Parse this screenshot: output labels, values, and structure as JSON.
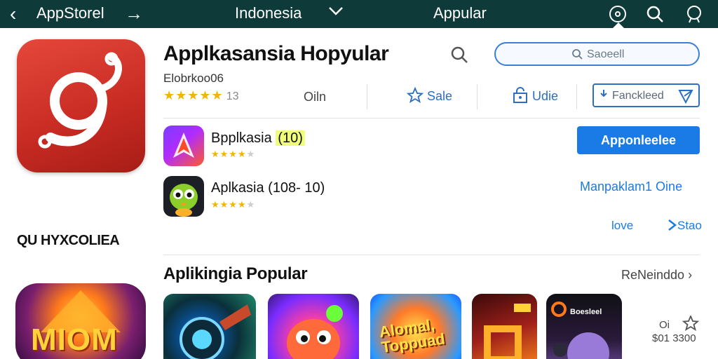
{
  "topbar": {
    "back_glyph": "‹",
    "store_title": "AppStorel",
    "arrow_glyph": "→",
    "country": "Indonesia",
    "chevron_glyph": "⌄",
    "section": "Appular",
    "bg_color": "#0e3a3a"
  },
  "left": {
    "label": "QU HYXCOLIEA",
    "bottom_icon_word": "MIOM"
  },
  "header": {
    "title": "Applkasansia Hopyular",
    "subtitle": "Elobrkoo06",
    "search_placeholder": "Saoeell"
  },
  "meta": {
    "stars": "★★★★★",
    "rating_count": "13",
    "on_label": "Oiln",
    "sale_label": "Sale",
    "lock_label": "Udie",
    "download_label": "Fanckleed"
  },
  "apps": [
    {
      "name": "Bpplkasia",
      "tag": "(10)",
      "stars_on": "★★★★",
      "stars_off": "★"
    },
    {
      "name": "Aplkasia (108- 10)",
      "stars_on": "★★★★",
      "stars_off": "★"
    }
  ],
  "actions": {
    "primary": "Apponleelee",
    "link1": "Manpaklam1 Oine",
    "link2": "love",
    "link3": "Stao"
  },
  "popular": {
    "title": "Aplikingia Popular",
    "see_all": "ReNeinddo",
    "see_all_chevron": "›",
    "tile3_text": "Alomal, Toppuad",
    "tile5_text": "Boesleel",
    "side_top": "Oi",
    "side_bottom": "$01 3300"
  },
  "colors": {
    "accent": "#1a7be6",
    "star": "#f3b500"
  }
}
